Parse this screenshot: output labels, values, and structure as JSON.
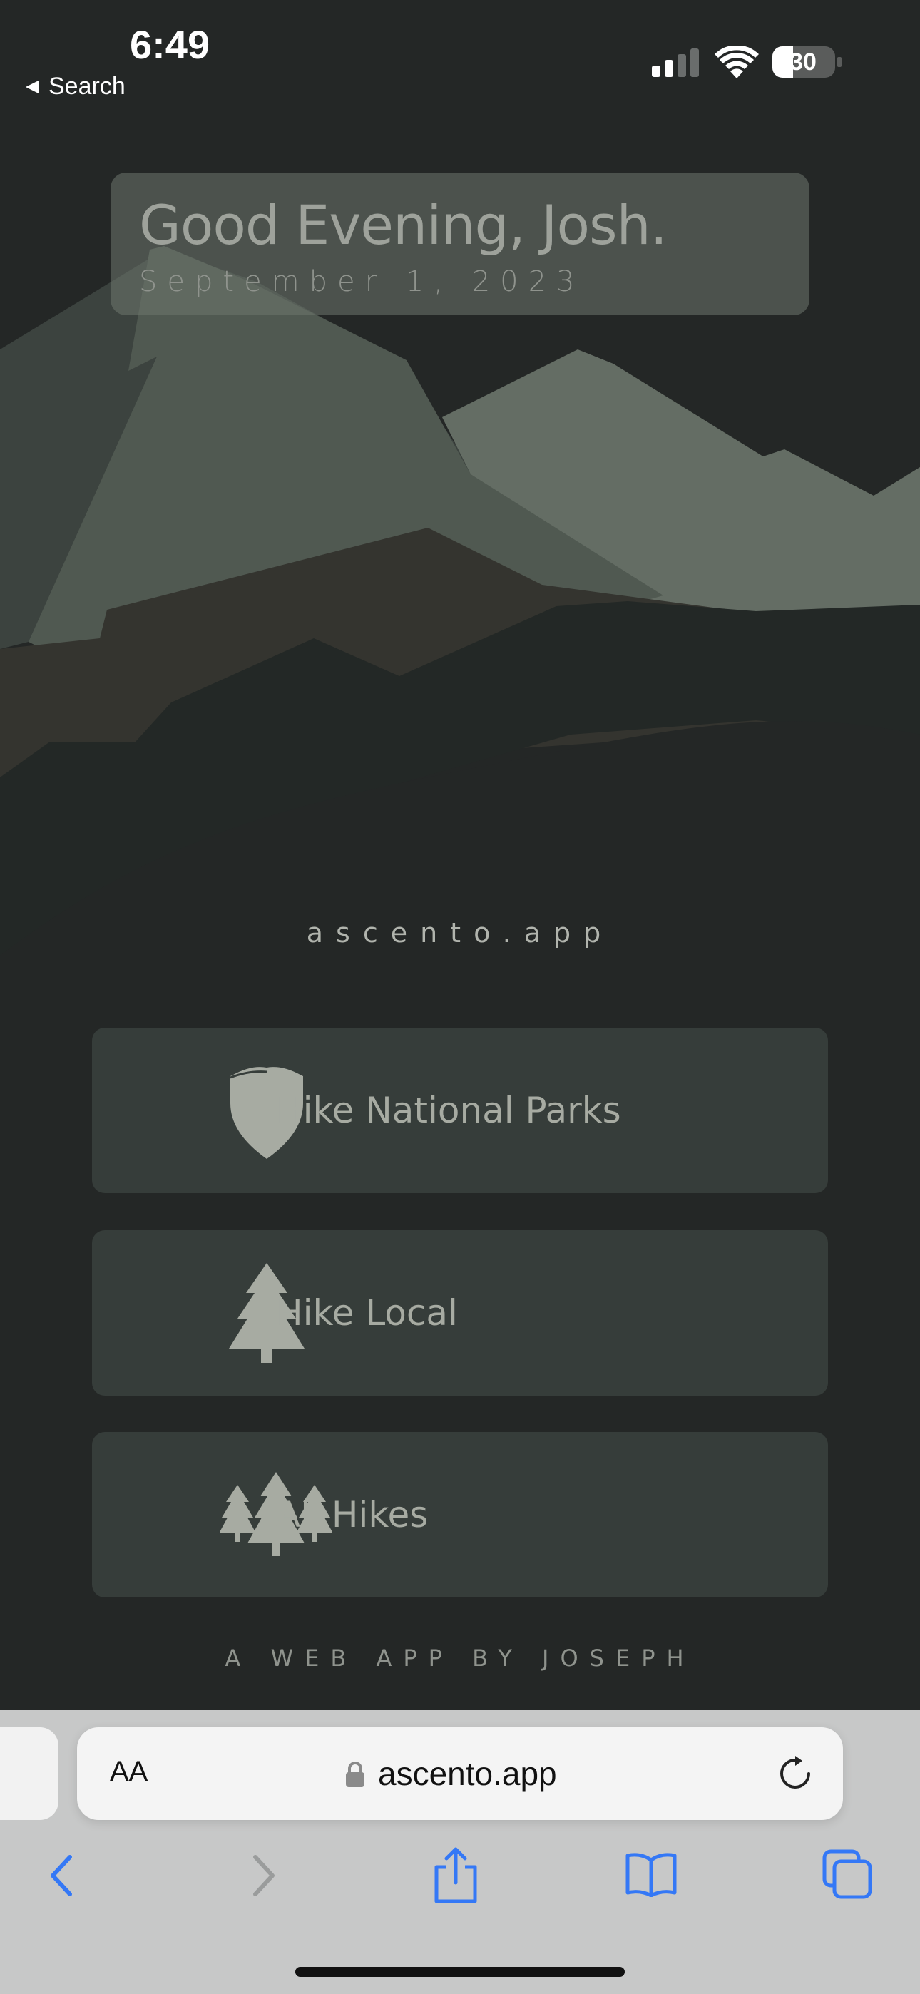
{
  "status_bar": {
    "time": "6:49",
    "back_label": "Search",
    "battery": "30"
  },
  "greeting": {
    "title": "Good Evening, Josh.",
    "date": "September 1, 2023"
  },
  "site_label": "ascento.app",
  "nav": [
    {
      "label": "Hike National Parks",
      "icon": "shield-icon"
    },
    {
      "label": "Hike Local",
      "icon": "tree-icon"
    },
    {
      "label": "All Hikes",
      "icon": "forest-icon"
    }
  ],
  "byline": "A WEB APP BY JOSEPH",
  "browser": {
    "text_size_label": "AA",
    "url": "ascento.app"
  },
  "colors": {
    "background": "#242726",
    "card": "#363d3a",
    "icon": "#a7aba2",
    "accent_blue": "#3478f6"
  }
}
